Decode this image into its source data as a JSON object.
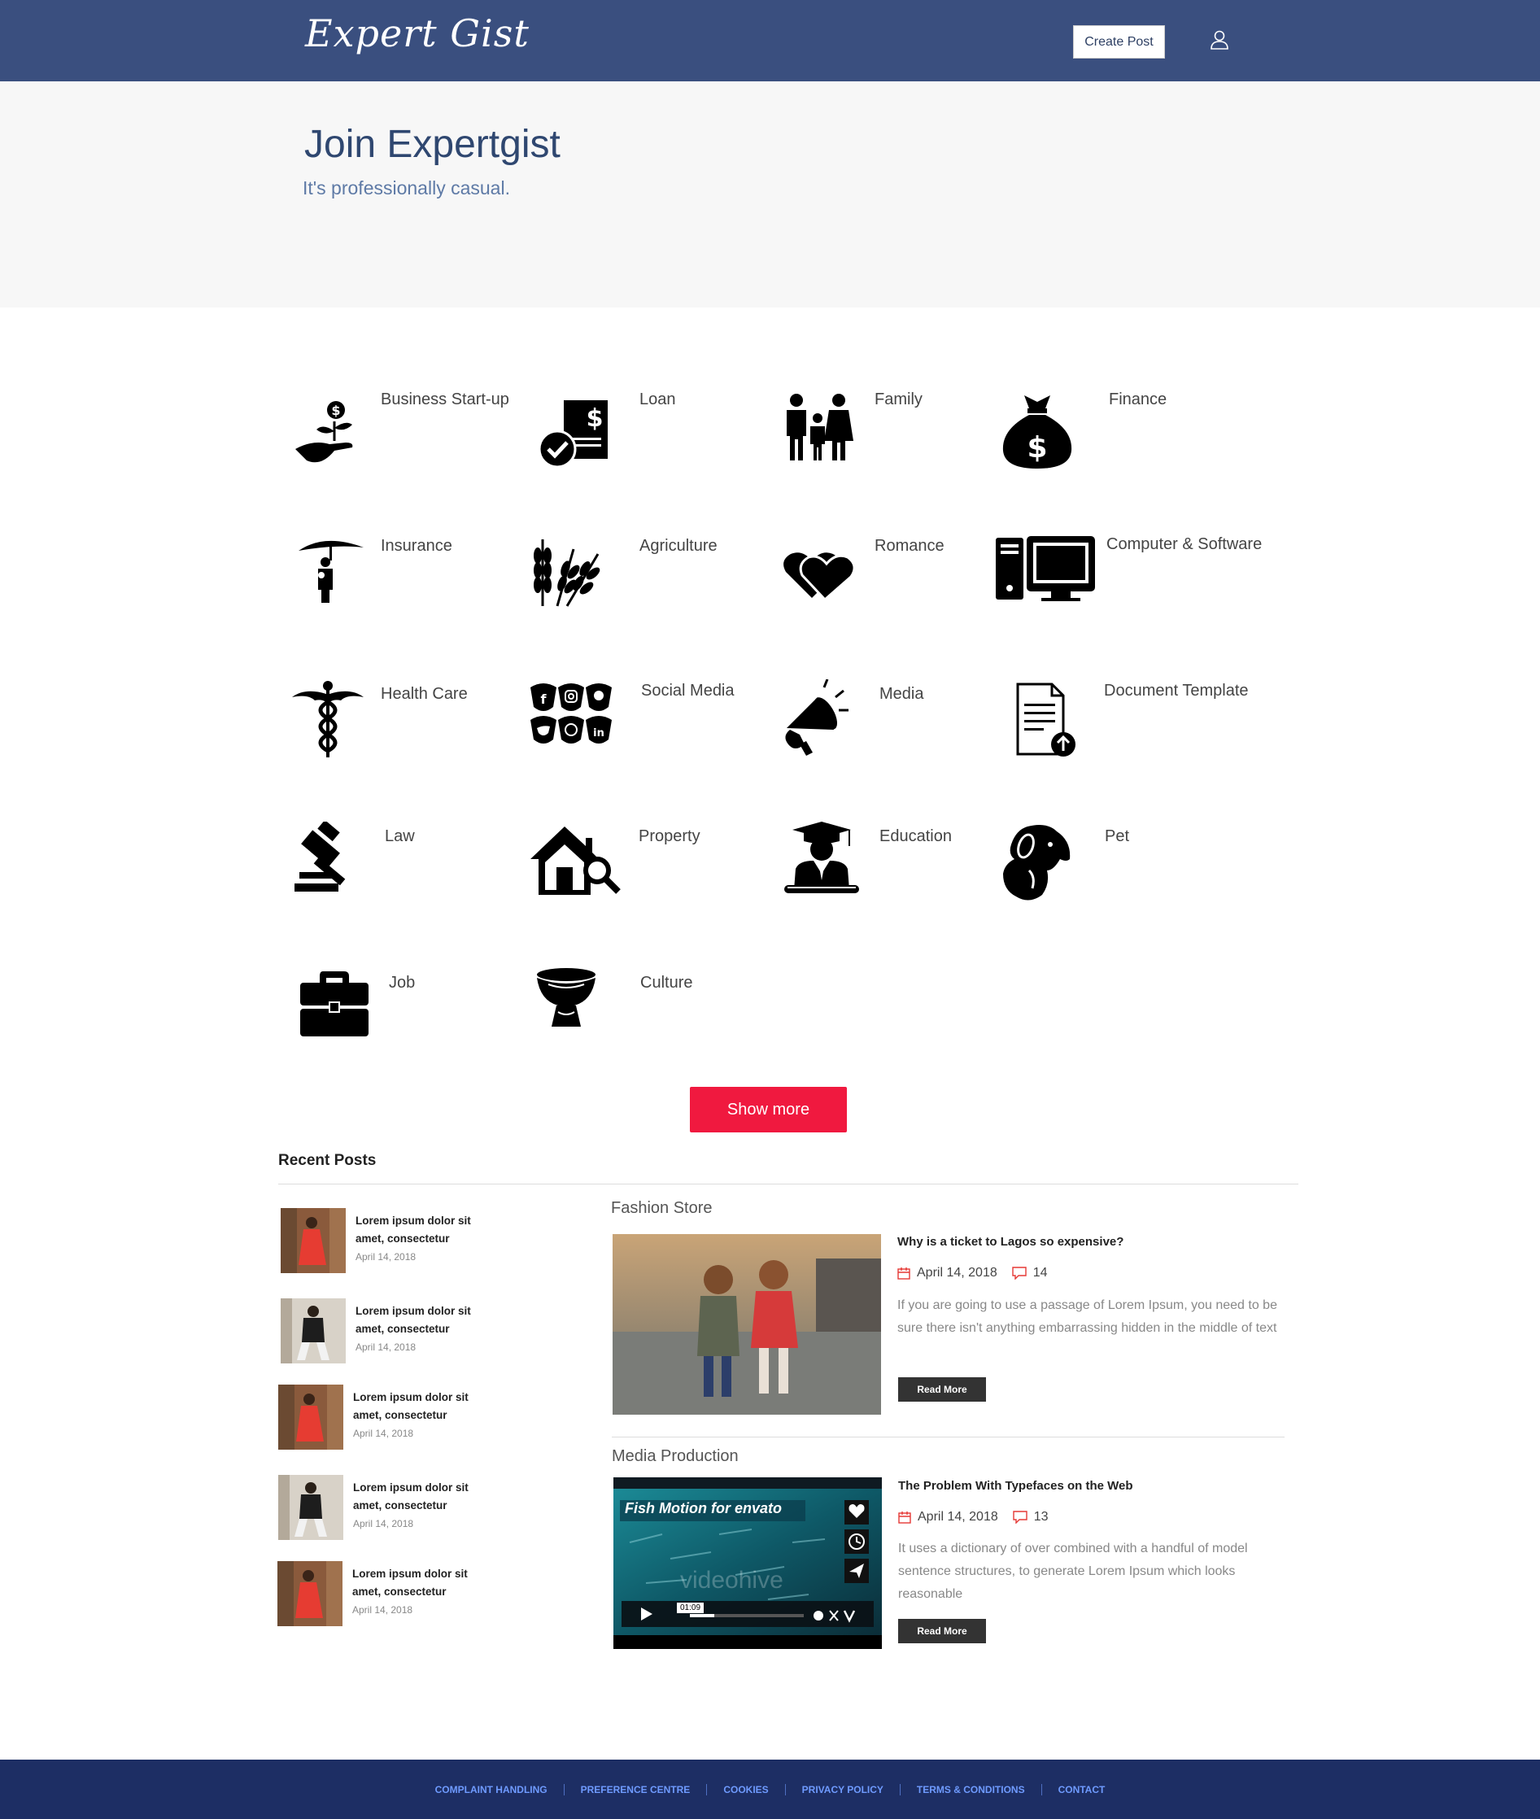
{
  "header": {
    "logo": "Expert Gist",
    "create_post": "Create Post"
  },
  "hero": {
    "title": "Join Expertgist",
    "subtitle": "It's professionally casual."
  },
  "categories": [
    {
      "label": "Business Start-up",
      "icon": "plant-in-hand-icon"
    },
    {
      "label": "Loan",
      "icon": "loan-document-icon"
    },
    {
      "label": "Family",
      "icon": "family-icon"
    },
    {
      "label": "Finance",
      "icon": "money-bag-icon"
    },
    {
      "label": "Insurance",
      "icon": "umbrella-family-icon"
    },
    {
      "label": "Agriculture",
      "icon": "wheat-icon"
    },
    {
      "label": "Romance",
      "icon": "hearts-icon"
    },
    {
      "label": "Computer & Software",
      "icon": "computer-icon"
    },
    {
      "label": "Health Care",
      "icon": "caduceus-icon"
    },
    {
      "label": "Social Media",
      "icon": "social-media-icon"
    },
    {
      "label": "Media",
      "icon": "megaphone-icon"
    },
    {
      "label": "Document Template",
      "icon": "document-upload-icon"
    },
    {
      "label": "Law",
      "icon": "gavel-icon"
    },
    {
      "label": "Property",
      "icon": "house-search-icon"
    },
    {
      "label": "Education",
      "icon": "graduate-icon"
    },
    {
      "label": "Pet",
      "icon": "dog-icon"
    },
    {
      "label": "Job",
      "icon": "briefcase-icon"
    },
    {
      "label": "Culture",
      "icon": "culture-bowl-icon"
    }
  ],
  "show_more": "Show more",
  "recent": {
    "title": "Recent Posts",
    "items": [
      {
        "line1": "Lorem ipsum dolor sit",
        "line2": "amet, consectetur",
        "date": "April 14, 2018"
      },
      {
        "line1": "Lorem ipsum dolor sit",
        "line2": "amet, consectetur",
        "date": "April 14, 2018"
      },
      {
        "line1": "Lorem ipsum dolor sit",
        "line2": "amet, consectetur",
        "date": "April 14, 2018"
      },
      {
        "line1": "Lorem ipsum dolor sit",
        "line2": "amet, consectetur",
        "date": "April 14, 2018"
      },
      {
        "line1": "Lorem ipsum dolor sit",
        "line2": "amet, consectetur",
        "date": "April 14, 2018"
      }
    ]
  },
  "posts": [
    {
      "section": "Fashion Store",
      "title": "Why is a ticket to Lagos so expensive?",
      "date": "April 14, 2018",
      "comments": "14",
      "excerpt": "If you are going to use a passage of Lorem Ipsum, you need to be sure there isn't anything embarrassing hidden in the middle of text",
      "read_more": "Read More"
    },
    {
      "section": "Media Production",
      "title": "The Problem With Typefaces on the Web",
      "date": "April 14, 2018",
      "comments": "13",
      "excerpt": "It uses a dictionary of over combined with a handful of model sentence structures, to generate Lorem Ipsum which looks reasonable",
      "read_more": "Read More",
      "video_title": "Fish Motion for envato",
      "video_time": "01:09",
      "watermark": "videohive"
    }
  ],
  "footer": [
    "COMPLAINT HANDLING",
    "PREFERENCE CENTRE",
    "COOKIES",
    "PRIVACY POLICY",
    "TERMS & CONDITIONS",
    "CONTACT"
  ],
  "colors": {
    "header": "#3a4f7f",
    "accent": "#f0193f",
    "footer": "#1d2e64"
  }
}
